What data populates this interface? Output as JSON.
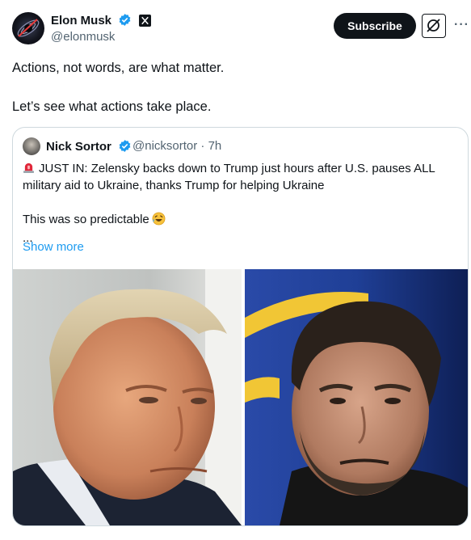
{
  "author": {
    "name": "Elon Musk",
    "handle": "@elonmusk",
    "avatar_icon": "galaxy-avatar",
    "verified_color": "#1d9bf0"
  },
  "actions": {
    "subscribe_label": "Subscribe",
    "grok_icon": "grok-icon",
    "more_label": "···"
  },
  "tweet": {
    "lines": [
      "Actions, not words, are what matter.",
      "Let’s see what actions take place."
    ]
  },
  "quote": {
    "name": "Nick Sortor",
    "handle": "@nicksortor",
    "separator": "·",
    "time": "7h",
    "headline": "JUST IN: Zelensky backs down to Trump just hours after U.S. pauses ALL military aid to Ukraine, thanks Trump for helping Ukraine",
    "line2": "This was so predictable",
    "ellipsis": "...",
    "show_more": "Show more",
    "emoji_siren": "rotating-light-icon",
    "emoji_laugh": "rolling-laughing-icon"
  },
  "colors": {
    "text": "#0f1419",
    "secondary": "#536471",
    "link": "#1d9bf0",
    "border": "#cfd9de"
  }
}
